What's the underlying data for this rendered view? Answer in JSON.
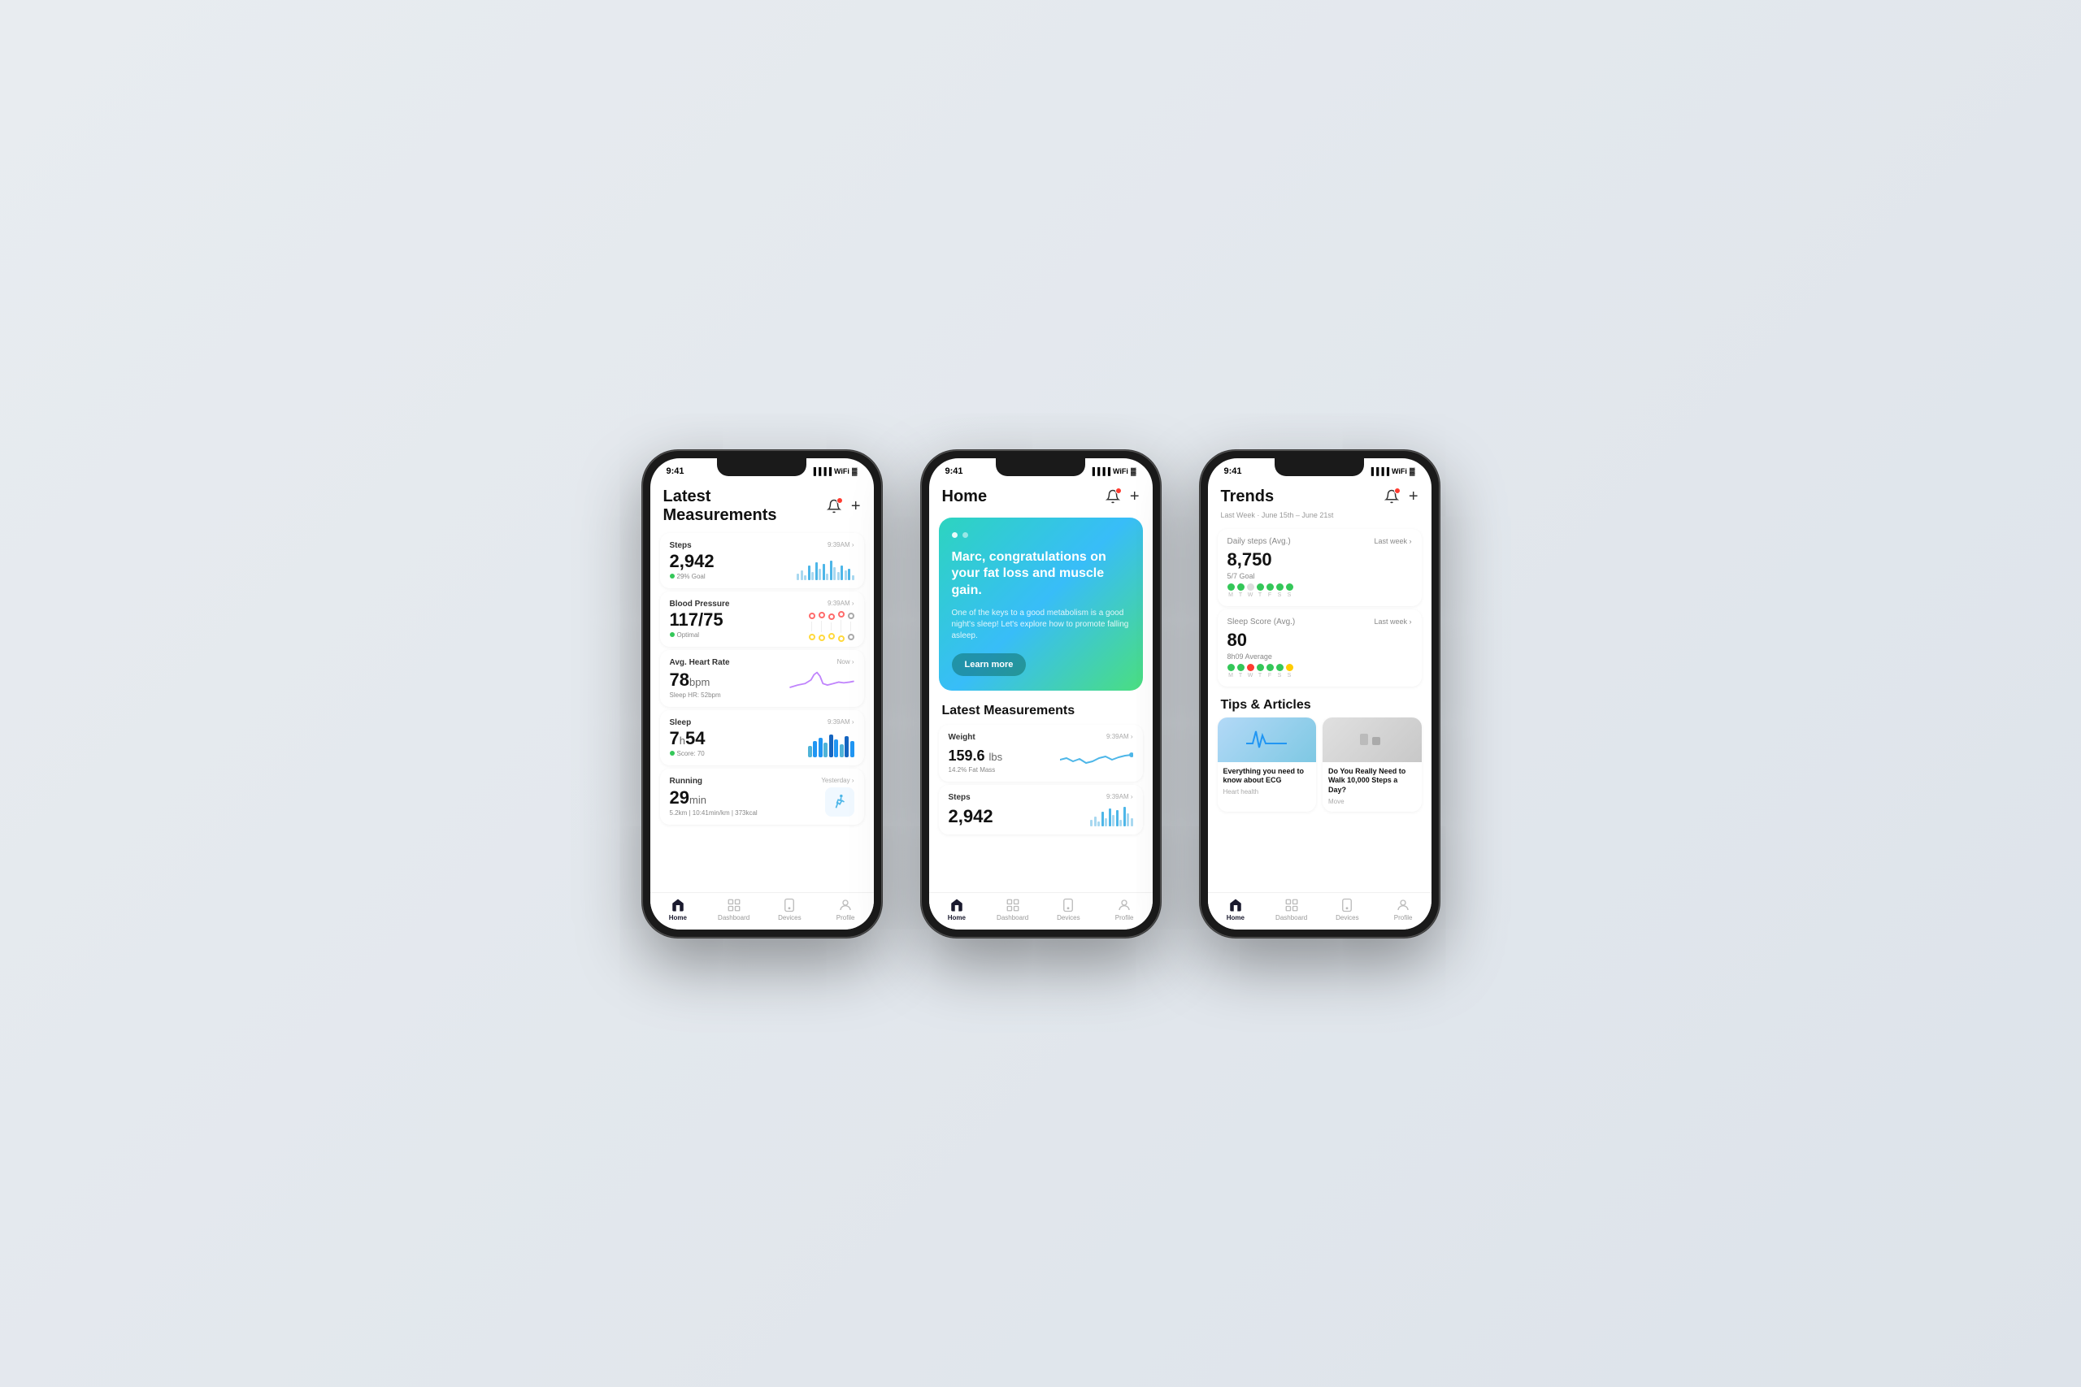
{
  "background": "#e8ecf0",
  "phones": [
    {
      "id": "phone1",
      "screen": "latest-measurements",
      "statusTime": "9:41",
      "header": "Latest Measurements",
      "measurements": [
        {
          "title": "Steps",
          "time": "9:39AM",
          "value": "2,942",
          "unit": "",
          "sub": "29% Goal",
          "dotColor": "green",
          "chartType": "bars"
        },
        {
          "title": "Blood Pressure",
          "time": "9:39AM",
          "value": "117/75",
          "unit": "",
          "sub": "Optimal",
          "dotColor": "green",
          "chartType": "bp"
        },
        {
          "title": "Avg. Heart Rate",
          "time": "Now",
          "value": "78",
          "unit": "bpm",
          "sub": "Sleep HR: 52bpm",
          "dotColor": "none",
          "chartType": "line"
        },
        {
          "title": "Sleep",
          "time": "9:39AM",
          "value": "7h54",
          "unit": "",
          "sub": "Score: 70",
          "dotColor": "green",
          "chartType": "sleep-bars"
        },
        {
          "title": "Running",
          "time": "Yesterday",
          "value": "29",
          "unit": "min",
          "sub": "5.2km | 10:41min/km | 373kcal",
          "dotColor": "none",
          "chartType": "running"
        }
      ],
      "nav": [
        "Home",
        "Dashboard",
        "Devices",
        "Profile"
      ],
      "activeNav": "Home"
    },
    {
      "id": "phone2",
      "screen": "home",
      "statusTime": "9:41",
      "header": "Home",
      "hero": {
        "title": "Marc, congratulations on your fat loss and muscle gain.",
        "sub": "One of the keys to a good metabolism is a good night's sleep! Let's explore how to promote falling asleep.",
        "btnLabel": "Learn more"
      },
      "latestMeasurementsTitle": "Latest Measurements",
      "measurements": [
        {
          "title": "Weight",
          "time": "9:39AM",
          "value": "159.6 lbs",
          "sub": "14.2% Fat Mass",
          "chartType": "weight-line"
        },
        {
          "title": "Steps",
          "time": "9:39AM",
          "value": "2,942",
          "sub": "",
          "chartType": "bars"
        }
      ],
      "nav": [
        "Home",
        "Dashboard",
        "Devices",
        "Profile"
      ],
      "activeNav": "Home"
    },
    {
      "id": "phone3",
      "screen": "trends",
      "statusTime": "9:41",
      "header": "Trends",
      "subheader": "Last Week · June 15th – June 21st",
      "trends": [
        {
          "title": "Daily steps (Avg.)",
          "link": "Last week",
          "value": "8,750",
          "goal": "5/7 Goal",
          "dots": [
            "green",
            "green",
            "gray",
            "green",
            "green",
            "green",
            "green"
          ],
          "days": [
            "M",
            "T",
            "W",
            "T",
            "F",
            "S",
            "S"
          ]
        },
        {
          "title": "Sleep Score (Avg.)",
          "link": "Last week",
          "value": "80",
          "goal": "8h09 Average",
          "dots": [
            "green",
            "green",
            "red",
            "green",
            "green",
            "green",
            "yellow"
          ],
          "days": [
            "M",
            "T",
            "W",
            "T",
            "F",
            "S",
            "S"
          ]
        }
      ],
      "tipsTitle": "Tips & Articles",
      "articles": [
        {
          "title": "Everything you need to know about ECG",
          "category": "Heart health",
          "imgType": "ecg"
        },
        {
          "title": "Do You Really Need to Walk 10,000 Steps a Day?",
          "category": "Move",
          "imgType": "steps"
        }
      ],
      "nav": [
        "Home",
        "Dashboard",
        "Devices",
        "Profile"
      ],
      "activeNav": "Home"
    }
  ]
}
